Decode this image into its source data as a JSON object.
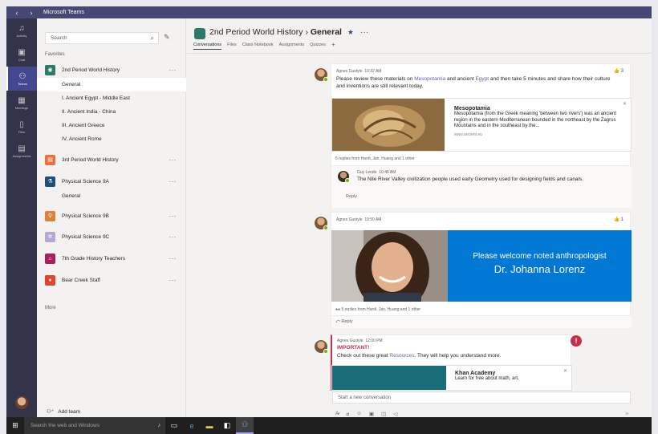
{
  "app": {
    "title": "Microsoft Teams"
  },
  "rail": [
    {
      "label": "Activity",
      "icon": "bell-icon"
    },
    {
      "label": "Chat",
      "icon": "chat-icon"
    },
    {
      "label": "Teams",
      "icon": "teams-icon",
      "active": true
    },
    {
      "label": "Meetings",
      "icon": "calendar-icon"
    },
    {
      "label": "Files",
      "icon": "file-icon"
    },
    {
      "label": "Assignments",
      "icon": "backpack-icon"
    }
  ],
  "left": {
    "search_placeholder": "Search",
    "favorites_label": "Favorites",
    "teams": [
      {
        "name": "2nd Period World History",
        "color": "#2b7a6b",
        "channels": [
          "General",
          "I. Ancient Egypt - Middle East",
          "II. Ancient India - China",
          "III. Ancient Greece",
          "IV. Ancient Rome"
        ]
      },
      {
        "name": "3rd Period World History",
        "color": "#e8733a"
      },
      {
        "name": "Physical Science 9A",
        "color": "#1f4e79",
        "channels": [
          "General"
        ]
      },
      {
        "name": "Physical Science 9B",
        "color": "#d9823b"
      },
      {
        "name": "Physical Science 9C",
        "color": "#b4a7d6"
      },
      {
        "name": "7th Grade History Teachers",
        "color": "#a5205c"
      },
      {
        "name": "Bear Creek Staff",
        "color": "#e0452b"
      }
    ],
    "more_label": "More",
    "add_team_label": "Add team"
  },
  "header": {
    "team": "2nd Period World History",
    "separator": "›",
    "channel": "General",
    "tabs": [
      "Conversations",
      "Files",
      "Class Notebook",
      "Assignments",
      "Quizzes"
    ]
  },
  "posts": [
    {
      "author": "Agnes Gustyle",
      "time": "10:32 AM",
      "likes": "3",
      "text_a": "Please review these materials on ",
      "link_a": "Mesopotamia",
      "text_b": " and ancient ",
      "link_b": "Egypt",
      "text_c": " and then take 5 minutes and share how their culture and inventions are still relevant today.",
      "card": {
        "title": "Mesopotamia",
        "desc": "Mesopotamia (from the Greek meaning 'between two rivers') was an ancient region in the eastern Mediterranean bounded in the northeast by the Zagros Mountains and in the southeast by the...",
        "url": "www.ancient.eu"
      },
      "replies_summary": "5 replies from Hardi, Jan, Huang and 1 other",
      "reply": {
        "author": "Guy Lendo",
        "time": "10:46 AM",
        "text": "The Nile River Valley civilization people used early Geometry used for designing fields and canals."
      },
      "reply_label": "Reply"
    },
    {
      "author": "Agnes Gustyle",
      "time": "10:50 AM",
      "likes": "1",
      "banner_line1": "Please welcome noted anthropologist",
      "banner_line2": "Dr. Johanna Lorenz",
      "replies_summary": "5 replies from Hardi, Jan, Huang and 1 other",
      "reply_label": "Reply"
    },
    {
      "author": "Agnes Gustyle",
      "time": "12:00 PM",
      "important": "IMPORTANT!",
      "text_a": "Check out these great ",
      "link_a": "Resources",
      "text_b": ". They will help you understand more.",
      "card": {
        "title": "Khan Academy",
        "desc": "Learn for free about math, art,"
      }
    }
  ],
  "compose": {
    "placeholder": "Start a new conversation"
  },
  "taskbar": {
    "search_placeholder": "Search the web and Windows"
  },
  "colors": {
    "brand": "#464775",
    "rail": "#33344a",
    "accent": "#6264a7",
    "important": "#c4314b",
    "banner": "#0078d4"
  }
}
